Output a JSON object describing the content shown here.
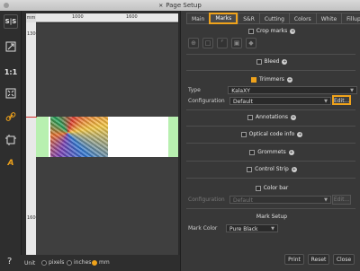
{
  "window": {
    "title": "Page Setup"
  },
  "toolbar": {
    "icons": [
      "sis-icon",
      "pages-icon",
      "one-to-one-icon",
      "fit-icon",
      "link-icon",
      "marks-icon",
      "text-icon"
    ],
    "sis_label": "S|S",
    "ratio_label": "1:1",
    "text_label": "A"
  },
  "rulers": {
    "unit": "mm",
    "top_labels": [
      "1000",
      "1600"
    ],
    "left_labels": [
      "1300",
      "1600"
    ]
  },
  "units": {
    "label": "Unit",
    "options": [
      "pixels",
      "inches",
      "mm"
    ],
    "selected": "mm"
  },
  "tabs": [
    "Main",
    "Marks",
    "S&R",
    "Cutting",
    "Colors",
    "White",
    "Fillup"
  ],
  "active_tab": "Marks",
  "sections": {
    "crop_marks": "Crop marks",
    "bleed": "Bleed",
    "trimmers": "Trimmers",
    "annotations": "Annotations",
    "optical": "Optical code info",
    "grommets": "Grommets",
    "control_strip": "Control Strip",
    "color_bar": "Color bar",
    "mark_setup": "Mark Setup"
  },
  "trimmers": {
    "type_label": "Type",
    "type_value": "KalaXY",
    "config_label": "Configuration",
    "config_value": "Default",
    "edit_label": "Edit..."
  },
  "colorbar": {
    "config_label": "Configuration",
    "config_value": "Default",
    "edit_label": "Edit..."
  },
  "mark_setup": {
    "color_label": "Mark Color",
    "color_value": "Pure Black"
  },
  "buttons": {
    "print": "Print",
    "reset": "Reset",
    "close": "Close"
  },
  "colors": {
    "accent": "#f0a31b",
    "margin_green": "#b8f0b0"
  }
}
